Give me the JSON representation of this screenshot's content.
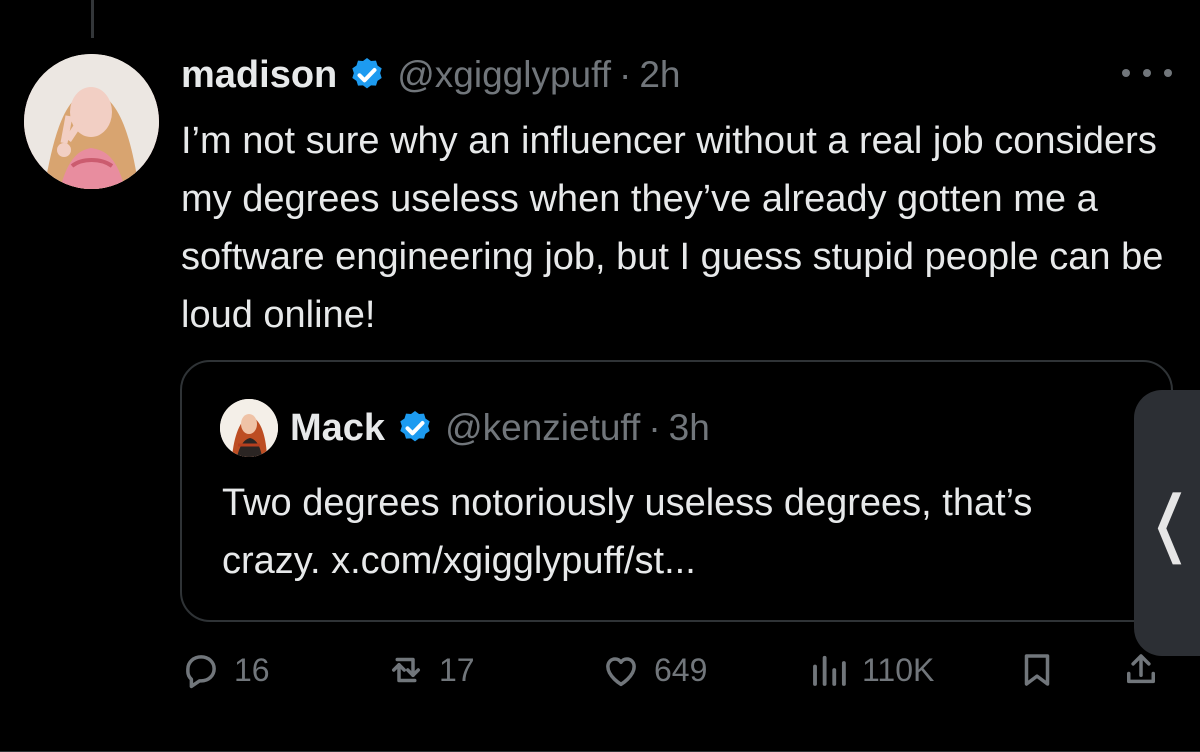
{
  "tweet": {
    "author": {
      "name": "madison",
      "handle": "@xgigglypuff",
      "separator": "·",
      "time": "2h"
    },
    "text": "I’m not sure why an influencer without a real job considers my degrees useless when they’ve already gotten me a software engineering job, but I guess stupid people can be loud online!",
    "quote": {
      "name": "Mack",
      "handle": "@kenzietuff",
      "separator": "·",
      "time": "3h",
      "text": "Two degrees notoriously useless degrees, that’s crazy. x.com/xgigglypuff/st..."
    },
    "actions": {
      "replies": "16",
      "reposts": "17",
      "likes": "649",
      "views": "110K"
    }
  },
  "side_tab_glyph": "❬",
  "colors": {
    "background": "#000000",
    "text": "#e7e9ea",
    "muted": "#71767b",
    "verified": "#1d9bf0",
    "border": "#2f3336"
  },
  "icons": [
    "verified-icon",
    "more-icon",
    "reply-icon",
    "repost-icon",
    "like-icon",
    "views-icon",
    "bookmark-icon",
    "share-icon"
  ]
}
